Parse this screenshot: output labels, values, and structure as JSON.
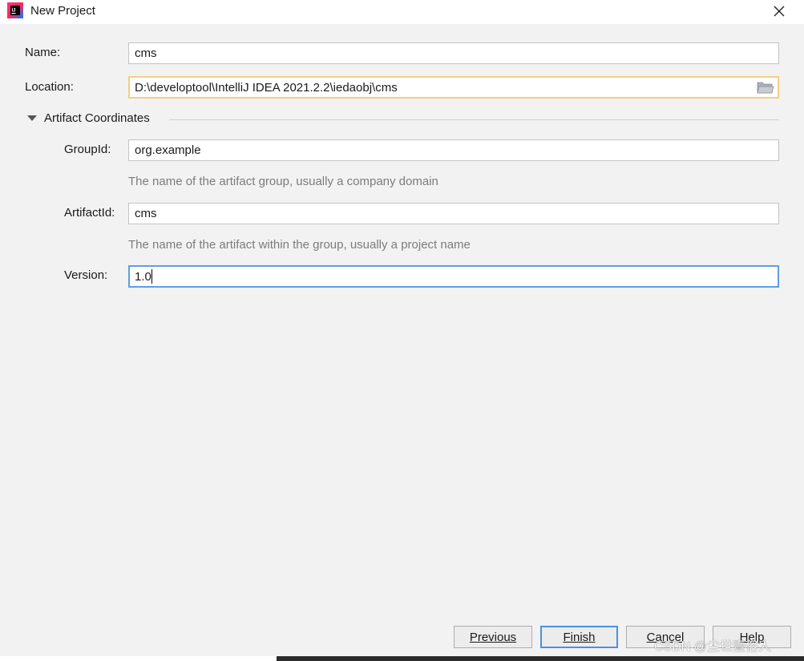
{
  "window": {
    "title": "New Project",
    "icons": {
      "app": "intellij-idea-icon",
      "close": "close-icon"
    }
  },
  "form": {
    "name": {
      "label": "Name:",
      "value": "cms"
    },
    "location": {
      "label": "Location:",
      "value": "D:\\developtool\\IntelliJ IDEA 2021.2.2\\iedaobj\\cms",
      "icon": "folder-icon"
    },
    "artifact_section": {
      "title": "Artifact Coordinates",
      "icon": "triangle-down-icon"
    },
    "group_id": {
      "label": "GroupId:",
      "value": "org.example",
      "hint": "The name of the artifact group, usually a company domain"
    },
    "artifact_id": {
      "label": "ArtifactId:",
      "value": "cms",
      "hint": "The name of the artifact within the group, usually a project name"
    },
    "version": {
      "label": "Version:",
      "value": "1.0"
    }
  },
  "buttons": {
    "previous": "Previous",
    "finish": "Finish",
    "cancel": "Cancel",
    "help": "Help"
  },
  "watermark": "CSDN @尘世壹俗人",
  "colors": {
    "focus_orange": "#f5cd84",
    "focus_blue": "#5f9ee2",
    "default_button": "#4a90e2"
  }
}
